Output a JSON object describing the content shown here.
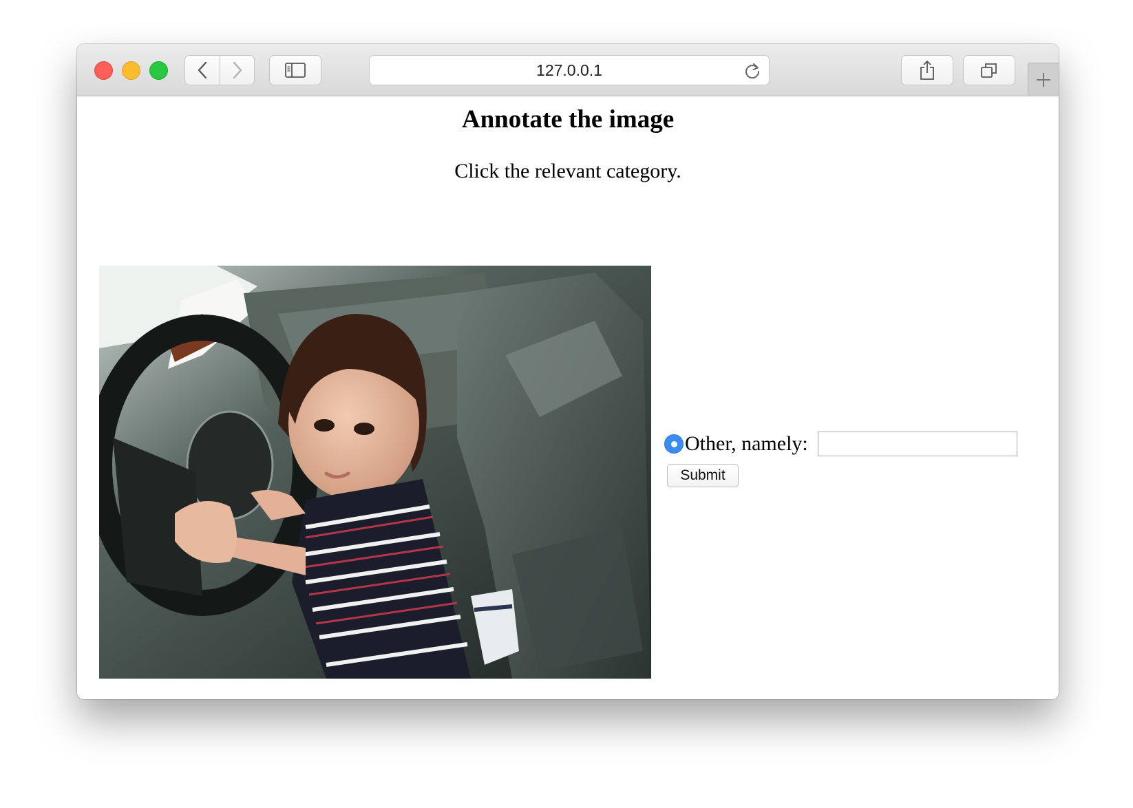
{
  "browser": {
    "url": "127.0.0.1",
    "icons": {
      "back": "chevron-left-icon",
      "forward": "chevron-right-icon",
      "sidebar": "sidebar-icon",
      "reload": "reload-icon",
      "share": "share-icon",
      "tabs": "tabs-icon",
      "new_tab": "plus-icon"
    }
  },
  "page": {
    "title": "Annotate the image",
    "instruction": "Click the relevant category."
  },
  "form": {
    "option_label": "Other, namely:",
    "option_selected": true,
    "text_value": "",
    "submit_label": "Submit"
  },
  "colors": {
    "radio_selected": "#3b8cf0",
    "close": "#fc5f57",
    "minimize": "#fdbc2f",
    "zoom": "#28c840"
  }
}
